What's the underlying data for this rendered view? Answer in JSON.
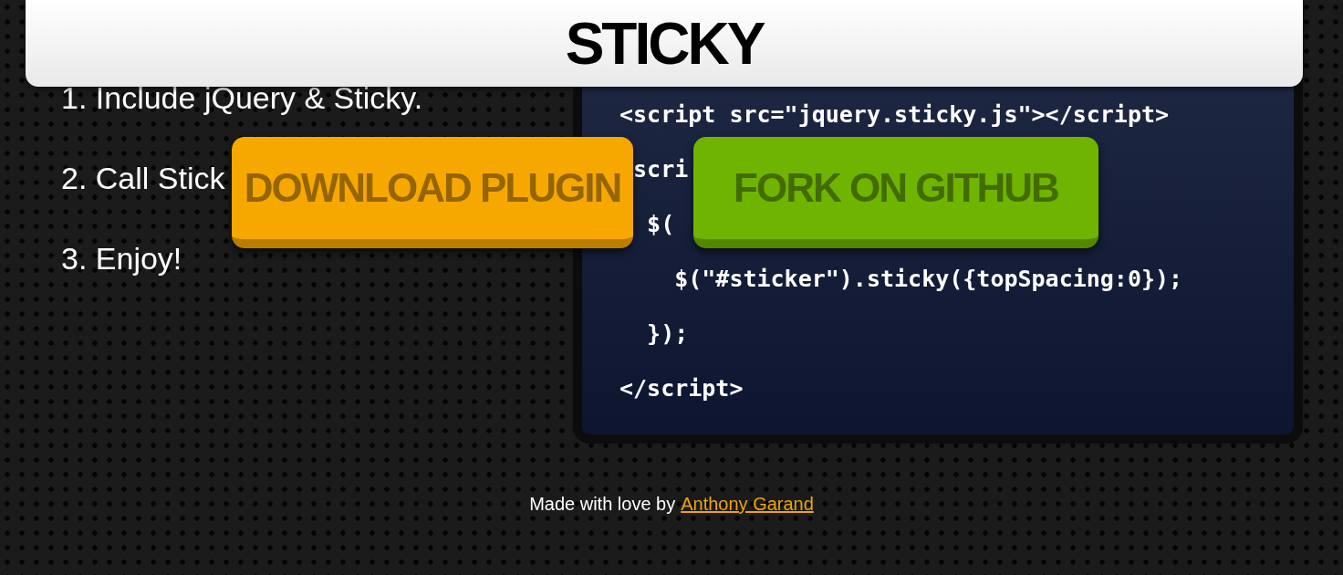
{
  "header": {
    "title": "STICKY"
  },
  "steps": [
    "1. Include jQuery & Sticky.",
    "2. Call Stick",
    "3. Enjoy!"
  ],
  "code_lines": [
    "<script src=\"jquery.sticky.js\"></script>",
    " scri",
    "  $(",
    "    $(\"#sticker\").sticky({topSpacing:0});",
    "  });",
    "</script>"
  ],
  "buttons": [
    {
      "label": "DOWNLOAD PLUGIN",
      "color": "#f7a800"
    },
    {
      "label": "FORK ON GITHUB",
      "color": "#6fb400"
    }
  ],
  "footer": {
    "text": "Made with love by",
    "link": "Anthony Garand"
  }
}
